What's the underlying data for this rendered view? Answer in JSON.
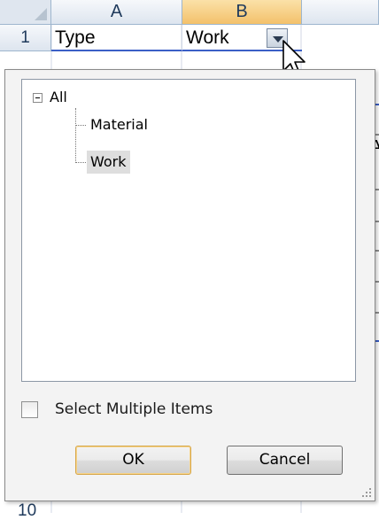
{
  "sheet": {
    "columns": [
      "A",
      "B"
    ],
    "rows": [
      "1"
    ],
    "row_fragment": "10",
    "cells": {
      "a1": "Type",
      "b1": "Work"
    },
    "peek_letter": "A"
  },
  "dropdown": {
    "tree": {
      "root": "All",
      "items": [
        "Material",
        "Work"
      ],
      "selected": "Work"
    },
    "select_multiple_label": "Select Multiple Items",
    "select_multiple_checked": false,
    "ok_label": "OK",
    "cancel_label": "Cancel"
  },
  "colors": {
    "selected_column_header": "#f3c16b",
    "filter_underline": "#3b5fc6",
    "ok_button_border": "#d6a64a"
  }
}
